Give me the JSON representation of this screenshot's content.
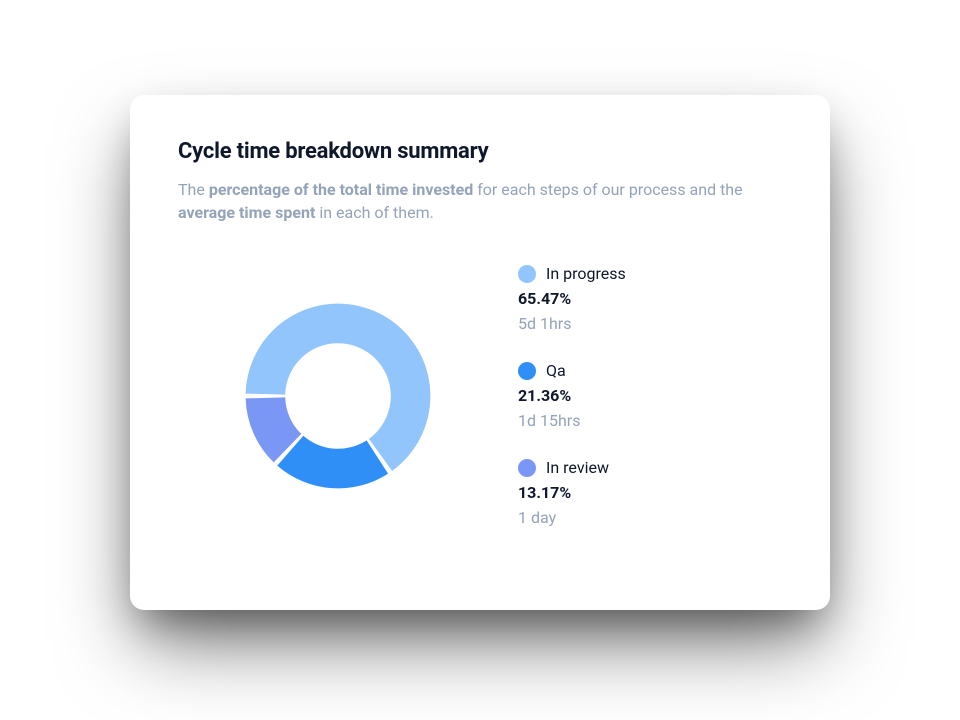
{
  "title": "Cycle time breakdown summary",
  "subtitle": {
    "pre": "The ",
    "bold1": "percentage of the total time invested",
    "mid": " for each steps of our process and the ",
    "bold2": "average time spent",
    "post": " in each of them."
  },
  "chart_data": {
    "type": "pie",
    "title": "Cycle time breakdown summary",
    "series": [
      {
        "name": "In progress",
        "value": 65.47,
        "color": "#93c5fd",
        "time": "5d 1hrs"
      },
      {
        "name": "Qa",
        "value": 21.36,
        "color": "#2f8ff7",
        "time": "1d 15hrs"
      },
      {
        "name": "In review",
        "value": 13.17,
        "color": "#7b97f5",
        "time": "1 day"
      }
    ]
  },
  "legend": [
    {
      "label": "In progress",
      "percent": "65.47%",
      "time": "5d 1hrs",
      "color": "#93c5fd"
    },
    {
      "label": "Qa",
      "percent": "21.36%",
      "time": "1d 15hrs",
      "color": "#2f8ff7"
    },
    {
      "label": "In review",
      "percent": "13.17%",
      "time": "1 day",
      "color": "#7b97f5"
    }
  ]
}
